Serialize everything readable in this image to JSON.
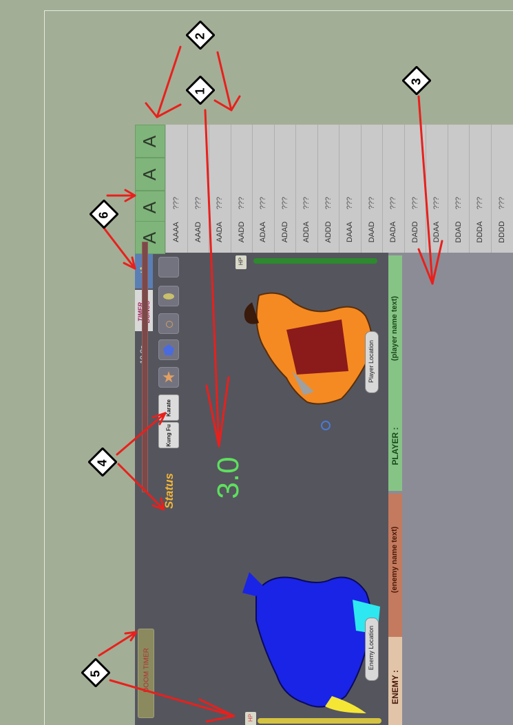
{
  "letter_buttons": [
    "A",
    "A",
    "A",
    "A"
  ],
  "combos": [
    {
      "code": "AAAA",
      "value": "???"
    },
    {
      "code": "AAAD",
      "value": "???"
    },
    {
      "code": "AADA",
      "value": "???"
    },
    {
      "code": "AADD",
      "value": "???"
    },
    {
      "code": "ADAA",
      "value": "???"
    },
    {
      "code": "ADAD",
      "value": "???"
    },
    {
      "code": "ADDA",
      "value": "???"
    },
    {
      "code": "ADDD",
      "value": "???"
    },
    {
      "code": "DAAA",
      "value": "???"
    },
    {
      "code": "DAAD",
      "value": "???"
    },
    {
      "code": "DADA",
      "value": "???"
    },
    {
      "code": "DADD",
      "value": "???"
    },
    {
      "code": "DDAA",
      "value": "???"
    },
    {
      "code": "DDAD",
      "value": "???"
    },
    {
      "code": "DDDA",
      "value": "???"
    },
    {
      "code": "DDDD",
      "value": "???"
    }
  ],
  "bonus": {
    "label": "+1"
  },
  "timer_bonus": {
    "line1": "TIMER",
    "line2": "BONUS"
  },
  "timer": {
    "value": "10.0s"
  },
  "doom_timer": {
    "label": "DOOM TIMER"
  },
  "fighting_styles": [
    "Kung Fu",
    "Karate"
  ],
  "status": {
    "label": "Status"
  },
  "countdown": {
    "value": "3.0"
  },
  "player": {
    "label": "PLAYER :",
    "name": "(player name text)",
    "location": "Player Location",
    "hp_label": "HP",
    "hp": 1.0
  },
  "enemy": {
    "label": "ENEMY :",
    "name": "(enemy name text)",
    "location": "Enemy Location",
    "hp_label": "HP",
    "hp": 1.0
  },
  "markers": [
    "1",
    "2",
    "3",
    "4",
    "5",
    "6"
  ],
  "colors": {
    "background": "#a3ae96",
    "game_bg": "#55555e",
    "letter_button": "#7fb47a",
    "player_hp": "#2d8a2d",
    "enemy_hp": "#d4c341",
    "countdown": "#5ee05e",
    "status": "#f2b637",
    "annotation": "#e8201c",
    "player_fur": "#f58a22",
    "enemy_fur": "#1a24e6"
  }
}
